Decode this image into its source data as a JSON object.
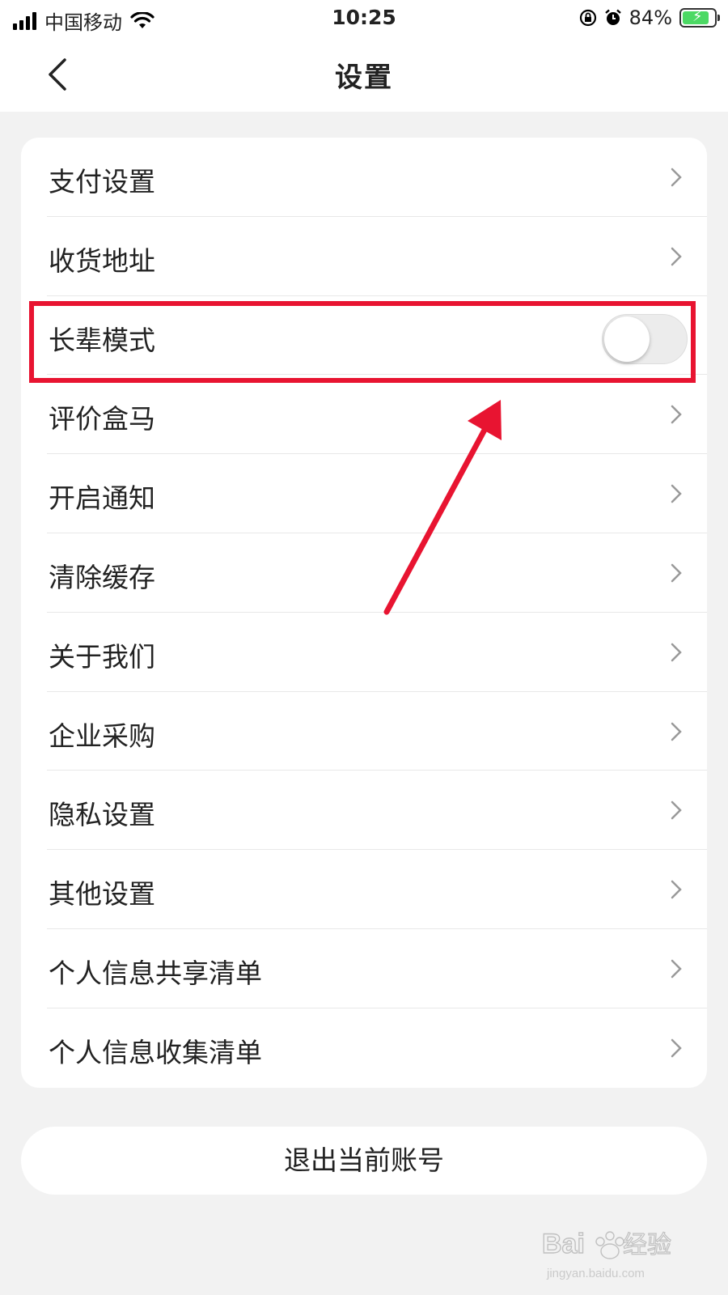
{
  "status_bar": {
    "carrier": "中国移动",
    "time": "10:25",
    "battery_percent": "84%"
  },
  "nav": {
    "title": "设置"
  },
  "settings": {
    "items": [
      {
        "label": "支付设置",
        "type": "chevron"
      },
      {
        "label": "收货地址",
        "type": "chevron"
      },
      {
        "label": "长辈模式",
        "type": "toggle",
        "toggle_on": false
      },
      {
        "label": "评价盒马",
        "type": "chevron"
      },
      {
        "label": "开启通知",
        "type": "chevron"
      },
      {
        "label": "清除缓存",
        "type": "chevron"
      },
      {
        "label": "关于我们",
        "type": "chevron"
      },
      {
        "label": "企业采购",
        "type": "chevron"
      },
      {
        "label": "隐私设置",
        "type": "chevron"
      },
      {
        "label": "其他设置",
        "type": "chevron"
      },
      {
        "label": "个人信息共享清单",
        "type": "chevron"
      },
      {
        "label": "个人信息收集清单",
        "type": "chevron"
      }
    ]
  },
  "logout": {
    "label": "退出当前账号"
  },
  "annotation": {
    "color": "#e81431"
  },
  "watermark": {
    "text": "Baidu经验",
    "url_text": "jingyan.baidu.com"
  }
}
